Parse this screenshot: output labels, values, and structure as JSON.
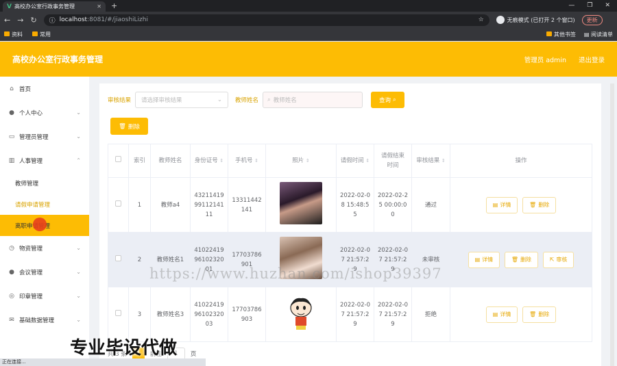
{
  "browser": {
    "tab_title": "高校办公室行政事务管理",
    "url_host": "localhost",
    "url_rest": ":8081/#/jiaoshiLizhi",
    "incognito_label": "无痕模式 (已打开 2 个窗口)",
    "update_label": "更新",
    "bookmarks": [
      "资料",
      "常用"
    ],
    "bookmarks_right": [
      "其他书签",
      "阅读清单"
    ],
    "status_text": "正在连接..."
  },
  "app": {
    "title": "高校办公室行政事务管理",
    "user_label": "管理员 admin",
    "logout_label": "退出登录",
    "accent": "#fdbc04"
  },
  "sidebar": {
    "items": [
      {
        "label": "首页",
        "icon": "home-icon"
      },
      {
        "label": "个人中心",
        "icon": "user-icon"
      },
      {
        "label": "管理员管理",
        "icon": "admin-icon"
      },
      {
        "label": "人事管理",
        "icon": "chart-icon"
      },
      {
        "label": "物资管理",
        "icon": "box-icon"
      },
      {
        "label": "会议管理",
        "icon": "meeting-icon"
      },
      {
        "label": "印章管理",
        "icon": "seal-icon"
      },
      {
        "label": "基础数据管理",
        "icon": "data-icon"
      }
    ],
    "sub_items": [
      "教师管理",
      "请假申请管理",
      "离职申请管理"
    ]
  },
  "search": {
    "label_result": "审核结果",
    "select_placeholder": "请选择审核结果",
    "label_name": "教师姓名",
    "input_placeholder": "教师姓名",
    "query_label": "查询",
    "delete_label": "删除"
  },
  "table": {
    "headers": [
      "索引",
      "教师姓名",
      "身份证号",
      "手机号",
      "照片",
      "请假时间",
      "请假结束时间",
      "审核结果",
      "操作"
    ],
    "rows": [
      {
        "index": "1",
        "name": "教师a4",
        "idcard": "432114199911214111",
        "phone": "13311442141",
        "leave_start": "2022-02-08 15:48:55",
        "leave_end": "2022-02-25 00:00:00",
        "result": "通过"
      },
      {
        "index": "2",
        "name": "教师姓名1",
        "idcard": "410224199610232001",
        "phone": "17703786901",
        "leave_start": "2022-02-07 21:57:29",
        "leave_end": "2022-02-07 21:57:29",
        "result": "未审核"
      },
      {
        "index": "3",
        "name": "教师姓名3",
        "idcard": "410224199610232003",
        "phone": "17703786903",
        "leave_start": "2022-02-07 21:57:29",
        "leave_end": "2022-02-07 21:57:29",
        "result": "拒绝"
      }
    ],
    "detail_label": "详情",
    "delete_label": "删除",
    "audit_label": "审核"
  },
  "pager": {
    "total_label": "共 3 条",
    "current_page": "1",
    "goto_label": "前往",
    "page_input": "1",
    "page_suffix": "页"
  },
  "watermarks": {
    "url_text": "https://www.huzhan.com/ishop39397",
    "big_text": "专业毕设代做"
  }
}
